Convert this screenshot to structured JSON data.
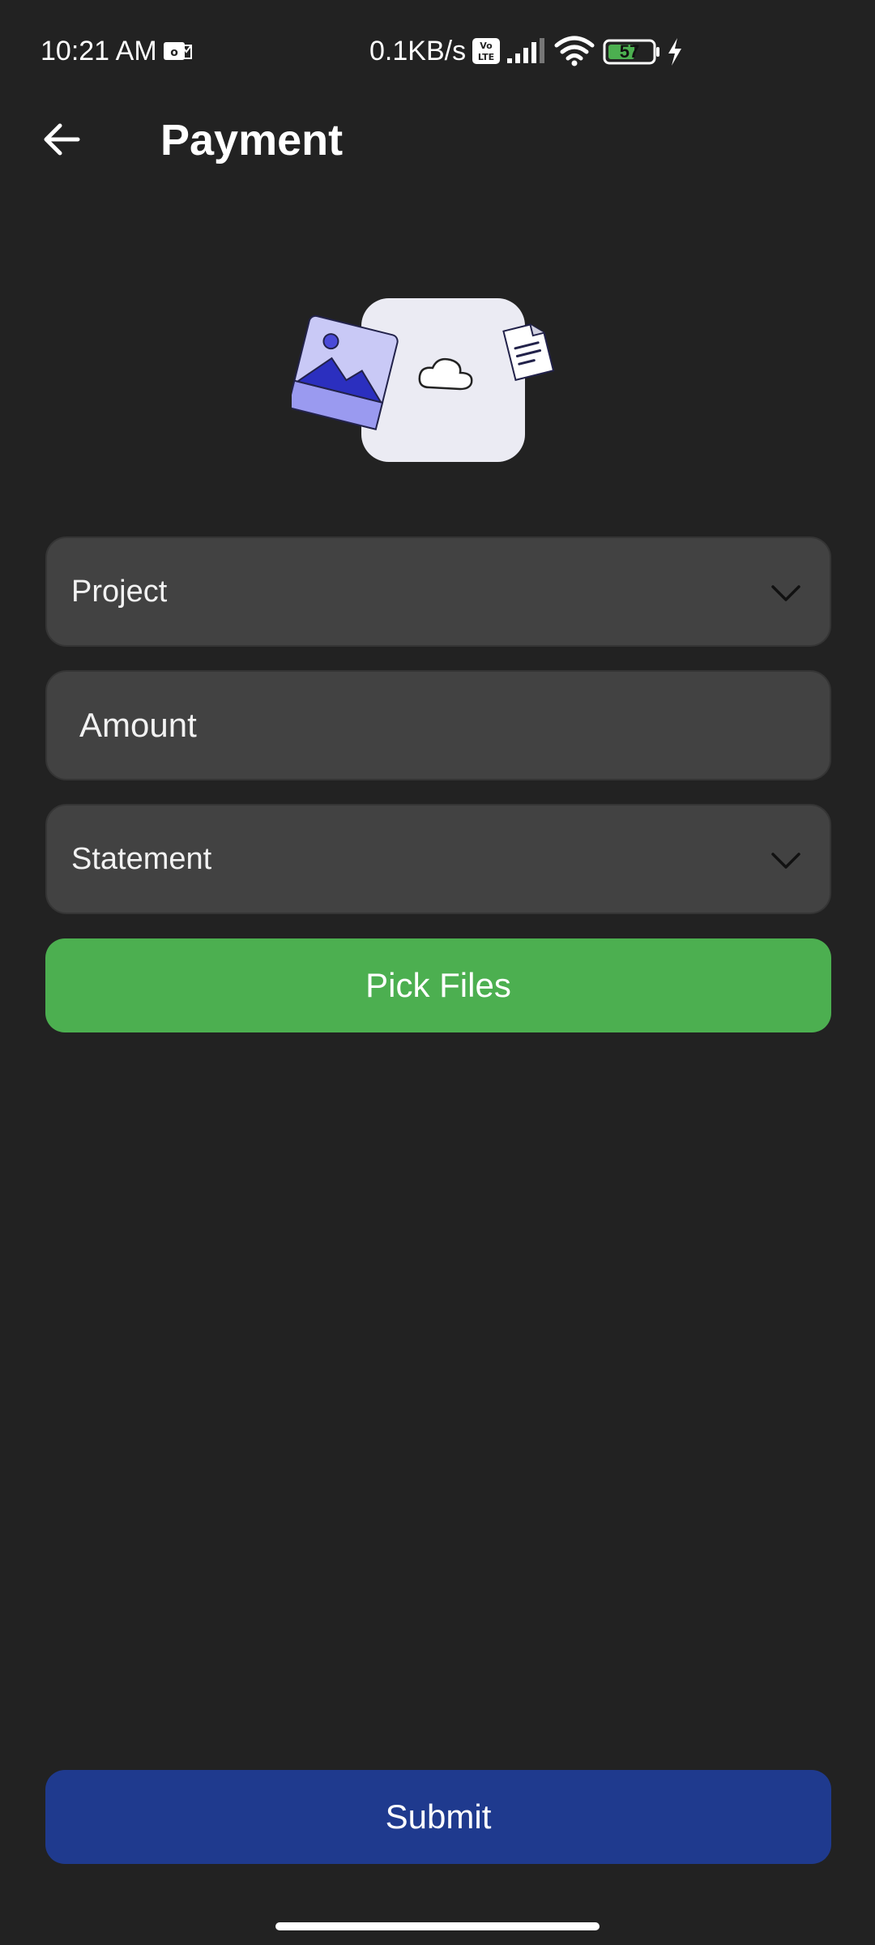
{
  "status_bar": {
    "time": "10:21 AM",
    "network_speed": "0.1KB/s",
    "battery_level": "57",
    "icons": [
      "mail-icon",
      "volte-icon",
      "signal-icon",
      "wifi-icon",
      "battery-icon",
      "charging-icon"
    ]
  },
  "app_bar": {
    "title": "Payment",
    "back_icon": "arrow-left-icon"
  },
  "illustration": {
    "icons": [
      "image-icon",
      "cloud-icon",
      "document-icon"
    ]
  },
  "form": {
    "project": {
      "label": "Project",
      "icon": "chevron-down-icon"
    },
    "amount": {
      "placeholder": "Amount",
      "value": ""
    },
    "statement": {
      "label": "Statement",
      "icon": "chevron-down-icon"
    },
    "pick_files_label": "Pick Files"
  },
  "footer": {
    "submit_label": "Submit"
  },
  "colors": {
    "background": "#222222",
    "field": "#424242",
    "pick_button": "#4caf50",
    "submit_button": "#1f3a8e",
    "illustration_accent": "#2b2fbf"
  }
}
